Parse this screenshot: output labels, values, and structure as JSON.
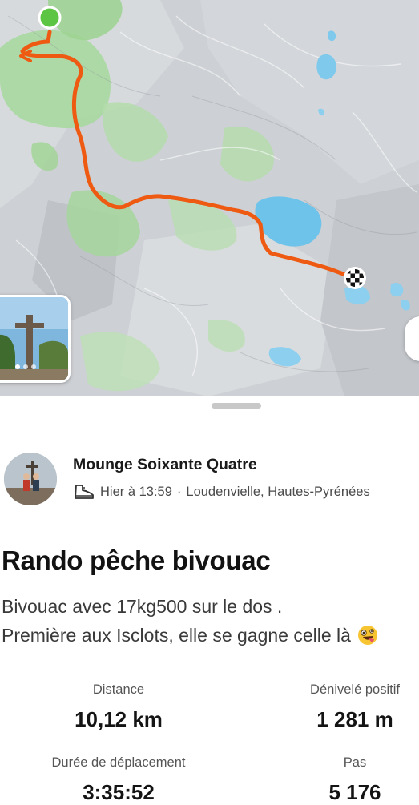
{
  "map": {
    "photo_count": 3,
    "route_color": "#ef5a13",
    "start_color": "#5cc644"
  },
  "activity": {
    "athlete_name": "Mounge Soixante Quatre",
    "sport_icon": "hiking-boot-icon",
    "date_time": "Hier à 13:59",
    "location": "Loudenvielle, Hautes-Pyrénées",
    "title": "Rando pêche bivouac",
    "description_line1": "Bivouac avec 17kg500 sur le dos .",
    "description_line2": "Première aux Isclots, elle se gagne celle là",
    "description_emoji": "zany-face-emoji"
  },
  "stats": {
    "distance": {
      "label": "Distance",
      "value": "10,12 km"
    },
    "elevation": {
      "label": "Dénivelé positif",
      "value": "1 281 m"
    },
    "moving_time": {
      "label": "Durée de déplacement",
      "value": "3:35:52"
    },
    "steps": {
      "label": "Pas",
      "value": "5 176"
    }
  }
}
